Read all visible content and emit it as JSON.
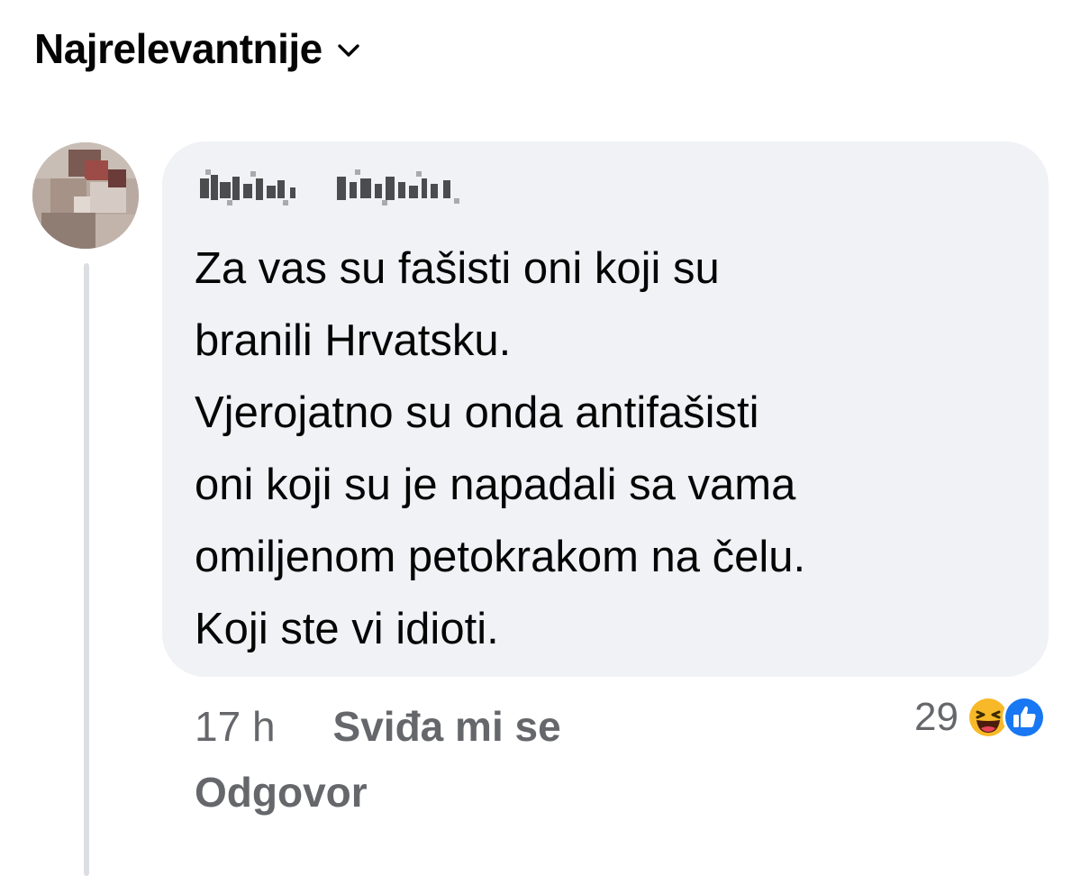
{
  "sort": {
    "label": "Najrelevantnije",
    "icon": "chevron-down-icon"
  },
  "comment": {
    "author_redacted": true,
    "avatar_blurred": true,
    "lines": [
      "Za vas su fašisti oni koji su",
      "branili Hrvatsku.",
      "Vjerojatno su onda antifašisti",
      "oni koji su je napadali sa vama",
      "omiljenom petokrakom na čelu.",
      "Koji ste vi idioti."
    ],
    "time": "17 h",
    "like_label": "Sviđa mi se",
    "reply_label": "Odgovor",
    "reactions": {
      "count": "29",
      "icons": [
        "haha-emoji-icon",
        "like-thumb-icon"
      ]
    }
  },
  "colors": {
    "bubble": "#f0f2f5",
    "secondary_text": "#65676b",
    "like_blue": "#1877f2",
    "haha_yellow": "#f7b928"
  }
}
